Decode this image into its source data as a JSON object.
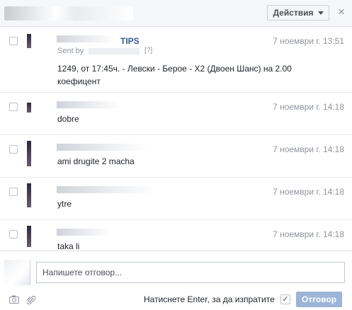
{
  "header": {
    "actions_label": "Действия",
    "close_symbol": "×"
  },
  "messages": [
    {
      "sender": "TIPS",
      "sent_by_label": "Sent by",
      "help": "[?]",
      "time": "7 ноември г. 13:51",
      "text": "1249, от 17:45ч. - Левски - Берое - Х2 (Двоен Шанс) на 2.00 коефицент"
    },
    {
      "time": "7 ноември г. 14:18",
      "text": "dobre"
    },
    {
      "time": "7 ноември г. 14:18",
      "text": "ami drugite 2 macha"
    },
    {
      "time": "7 ноември г. 14:18",
      "text": "ytre"
    },
    {
      "time": "7 ноември г. 14:18",
      "text": "taka li"
    }
  ],
  "composer": {
    "placeholder": "Напишете отговор...",
    "enter_label": "Натиснете Enter, за да изпратите",
    "send_label": "Отговор",
    "enter_checked": true,
    "icons": [
      "camera-icon",
      "paperclip-icon"
    ]
  },
  "colors": {
    "link": "#365899",
    "send_button": "#9cb4d8",
    "muted": "#90949c"
  }
}
